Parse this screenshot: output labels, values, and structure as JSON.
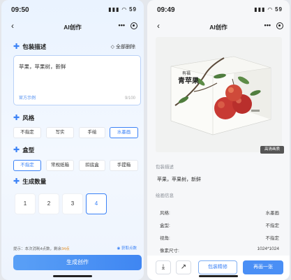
{
  "left": {
    "status": {
      "time": "09:50",
      "icons": "▮▮▮ ◠ 59"
    },
    "nav": {
      "title": "AI创作",
      "more": "•••"
    },
    "desc": {
      "title": "包装描述",
      "clear_label": "全部删除",
      "value": "苹果，苹果树，新鲜",
      "example_label": "官方示例",
      "counter": "9/100"
    },
    "style": {
      "title": "风格",
      "options": [
        "不指定",
        "写实",
        "手绘",
        "水墨画"
      ],
      "selected": 3
    },
    "box": {
      "title": "盒型",
      "options": [
        "不指定",
        "常规纸箱",
        "扣底盒",
        "手提箱"
      ],
      "selected": 0
    },
    "count": {
      "title": "生成数量",
      "options": [
        "1",
        "2",
        "3",
        "4"
      ],
      "selected": 3
    },
    "tip": {
      "prefix": "提示：本次消耗4点数，剩余",
      "points": "34点"
    },
    "help_label": "获取点数",
    "generate_label": "生成创作"
  },
  "right": {
    "status": {
      "time": "09:49",
      "icons": "▮▮▮ ◠ 59"
    },
    "nav": {
      "title": "AI创作",
      "more": "•••"
    },
    "badge": "高清画质",
    "product_brand": "有福",
    "product_name": "青苹果",
    "desc_label": "包装描述",
    "desc_value": "苹果，苹果树，新鲜",
    "info_label": "绘画信息",
    "info": [
      {
        "k": "风格:",
        "v": "水墨画"
      },
      {
        "k": "盒型:",
        "v": "不指定"
      },
      {
        "k": "视角:",
        "v": "不指定"
      },
      {
        "k": "像素尺寸:",
        "v": "1024*1024"
      }
    ],
    "refine_label": "包装精修",
    "again_label": "再画一张"
  },
  "colors": {
    "accent": "#3b82f6",
    "points": "#e08a1e"
  }
}
